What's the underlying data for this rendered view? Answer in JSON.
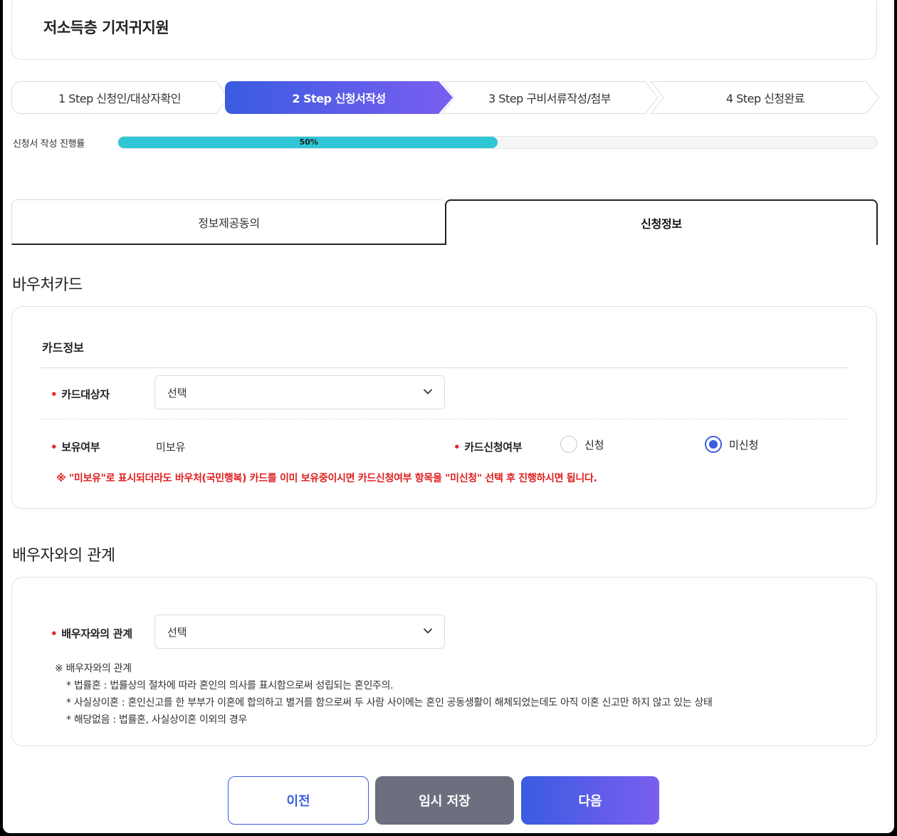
{
  "page": {
    "title": "저소득층 기저귀지원"
  },
  "steps": [
    {
      "label": "1 Step 신청인/대상자확인",
      "active": false
    },
    {
      "label": "2 Step 신청서작성",
      "active": true
    },
    {
      "label": "3 Step 구비서류작성/첨부",
      "active": false
    },
    {
      "label": "4 Step 신청완료",
      "active": false
    }
  ],
  "progress": {
    "label": "신청서 작성 진행률",
    "value": 50,
    "text": "50%"
  },
  "tabs": [
    {
      "label": "정보제공동의",
      "active": false
    },
    {
      "label": "신청정보",
      "active": true
    }
  ],
  "voucher": {
    "section_title": "바우처카드",
    "card_subtitle": "카드정보",
    "card_target": {
      "label": "카드대상자",
      "value": "선택"
    },
    "ownership": {
      "label": "보유여부",
      "value": "미보유"
    },
    "card_apply": {
      "label": "카드신청여부",
      "options": [
        {
          "label": "신청",
          "selected": false
        },
        {
          "label": "미신청",
          "selected": true
        }
      ]
    },
    "warning": "※ \"미보유\"로 표시되더라도 바우처(국민행복) 카드를 이미 보유중이시면 카드신청여부 항목을 \"미신청\" 선택 후 진행하시면 됩니다."
  },
  "spouse": {
    "section_title": "배우자와의 관계",
    "field": {
      "label": "배우자와의 관계",
      "value": "선택"
    },
    "notes": {
      "heading": "※ 배우자와의 관계",
      "lines": [
        "* 법률혼 : 법률상의 절차에 따라 혼인의 의사를 표시함으로써 성립되는 혼인주의.",
        "* 사실상이혼 : 혼인신고를 한 부부가 이혼에 합의하고 별거를 함으로써 두 사람 사이에는 혼인 공동생활이 해체되었는데도 아직 이혼 신고만 하지 않고 있는 상태",
        "* 해당없음 : 법률혼, 사실상이혼 이외의 경우"
      ]
    }
  },
  "buttons": {
    "prev": "이전",
    "save": "임시 저장",
    "next": "다음"
  },
  "colors": {
    "accent": "#3a5ce0",
    "progress": "#2fc6d6",
    "warning": "#e01e1e",
    "required": "#e22222"
  }
}
